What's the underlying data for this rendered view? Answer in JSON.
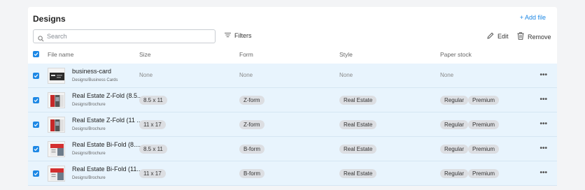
{
  "header": {
    "title": "Designs",
    "add_file": "+ Add file"
  },
  "toolbar": {
    "search_placeholder": "Search",
    "filters": "Filters",
    "edit": "Edit",
    "remove": "Remove"
  },
  "columns": {
    "file_name": "File name",
    "size": "Size",
    "form": "Form",
    "style": "Style",
    "paper_stock": "Paper stock"
  },
  "rows": [
    {
      "name": "business-card",
      "path": "Designs/Business Cards",
      "size": "None",
      "form": "None",
      "style": "None",
      "paper": [
        "None"
      ],
      "thumb": "dark-card"
    },
    {
      "name": "Real Estate Z-Fold (8.5...",
      "path": "Designs/Brochure",
      "size": "8.5 x 11",
      "form": "Z-form",
      "style": "Real Estate",
      "paper": [
        "Regular",
        "Premium"
      ],
      "thumb": "brochure-zfold"
    },
    {
      "name": "Real Estate Z-Fold (11 ...",
      "path": "Designs/Brochure",
      "size": "11 x 17",
      "form": "Z-form",
      "style": "Real Estate",
      "paper": [
        "Regular",
        "Premium"
      ],
      "thumb": "brochure-zfold"
    },
    {
      "name": "Real Estate Bi-Fold (8....",
      "path": "Designs/Brochure",
      "size": "8.5 x 11",
      "form": "B-form",
      "style": "Real Estate",
      "paper": [
        "Regular",
        "Premium"
      ],
      "thumb": "brochure-bifold"
    },
    {
      "name": "Real Estate Bi-Fold (11...",
      "path": "Designs/Brochure",
      "size": "11 x 17",
      "form": "B-form",
      "style": "Real Estate",
      "paper": [
        "Regular",
        "Premium"
      ],
      "thumb": "brochure-bifold"
    }
  ],
  "colors": {
    "accent": "#1e88e5",
    "row_selected": "#e8f4fd",
    "tag_bg": "#dcdee2"
  }
}
